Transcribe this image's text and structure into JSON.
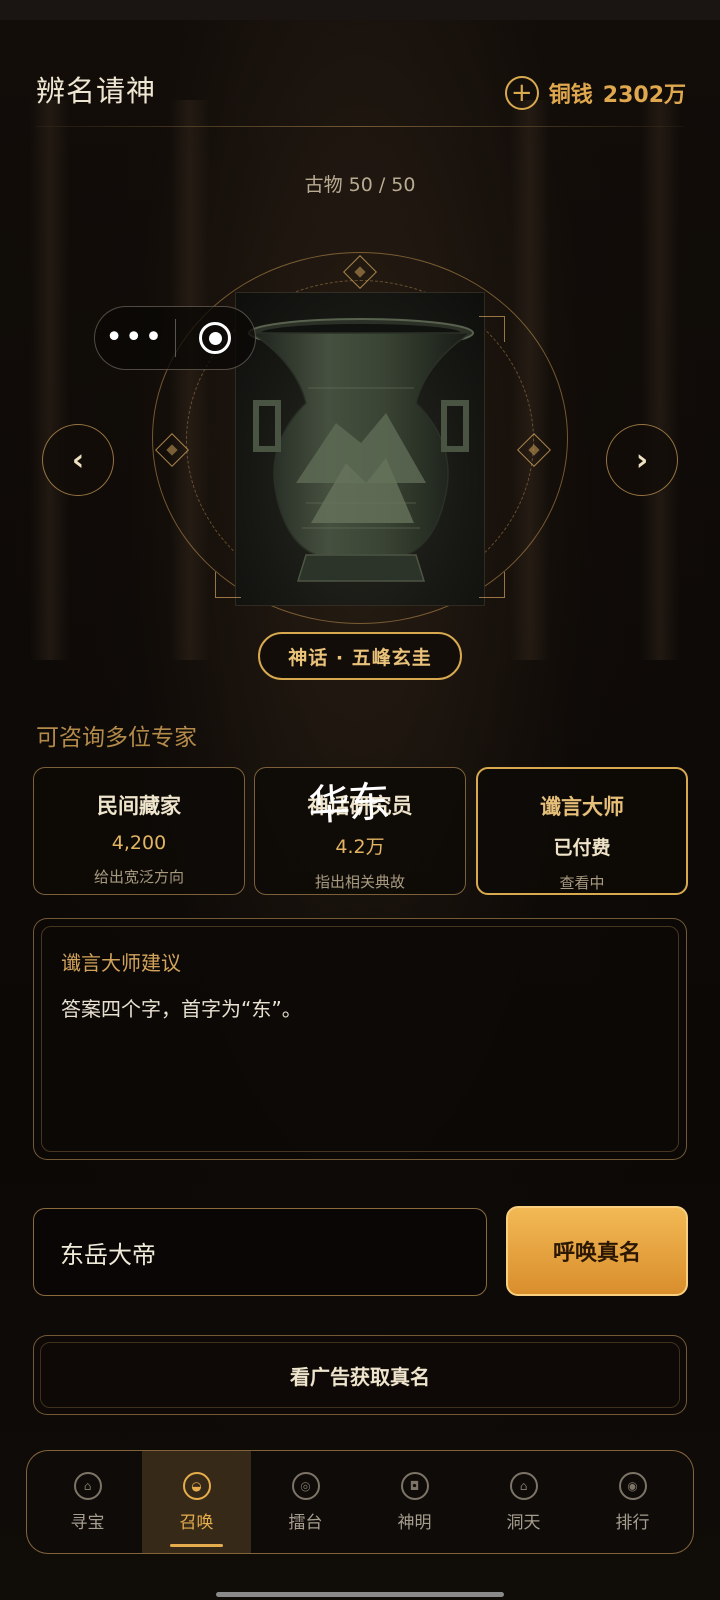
{
  "header": {
    "title": "辨名请神",
    "coins_label": "铜钱",
    "coins_value": "2302万"
  },
  "collection": {
    "count": "古物 50 / 50"
  },
  "artifact": {
    "name": "神话 · 五峰玄圭"
  },
  "experts_section": {
    "title": "可咨询多位专家",
    "overlay_text": "华东",
    "items": [
      {
        "name": "民间藏家",
        "price": "4,200",
        "desc": "给出宽泛方向"
      },
      {
        "name": "神话研究员",
        "price": "4.2万",
        "desc": "指出相关典故"
      },
      {
        "name": "谶言大师",
        "price": "已付费",
        "desc": "查看中"
      }
    ]
  },
  "advice": {
    "title": "谶言大师建议",
    "text": "答案四个字，首字为“东”。"
  },
  "answer": {
    "value": "东岳大帝",
    "submit_label": "呼唤真名"
  },
  "ad": {
    "label": "看广告获取真名"
  },
  "tabbar": {
    "items": [
      {
        "label": "寻宝",
        "icon": "treasure-icon"
      },
      {
        "label": "召唤",
        "icon": "summon-icon"
      },
      {
        "label": "擂台",
        "icon": "arena-icon"
      },
      {
        "label": "神明",
        "icon": "deity-icon"
      },
      {
        "label": "洞天",
        "icon": "grotto-icon"
      },
      {
        "label": "排行",
        "icon": "ranking-icon"
      }
    ],
    "active_index": 1
  },
  "colors": {
    "accent": "#d9a94f",
    "button_gradient_top": "#f2b955",
    "button_gradient_bottom": "#d98e2c",
    "background": "#0b0806"
  }
}
